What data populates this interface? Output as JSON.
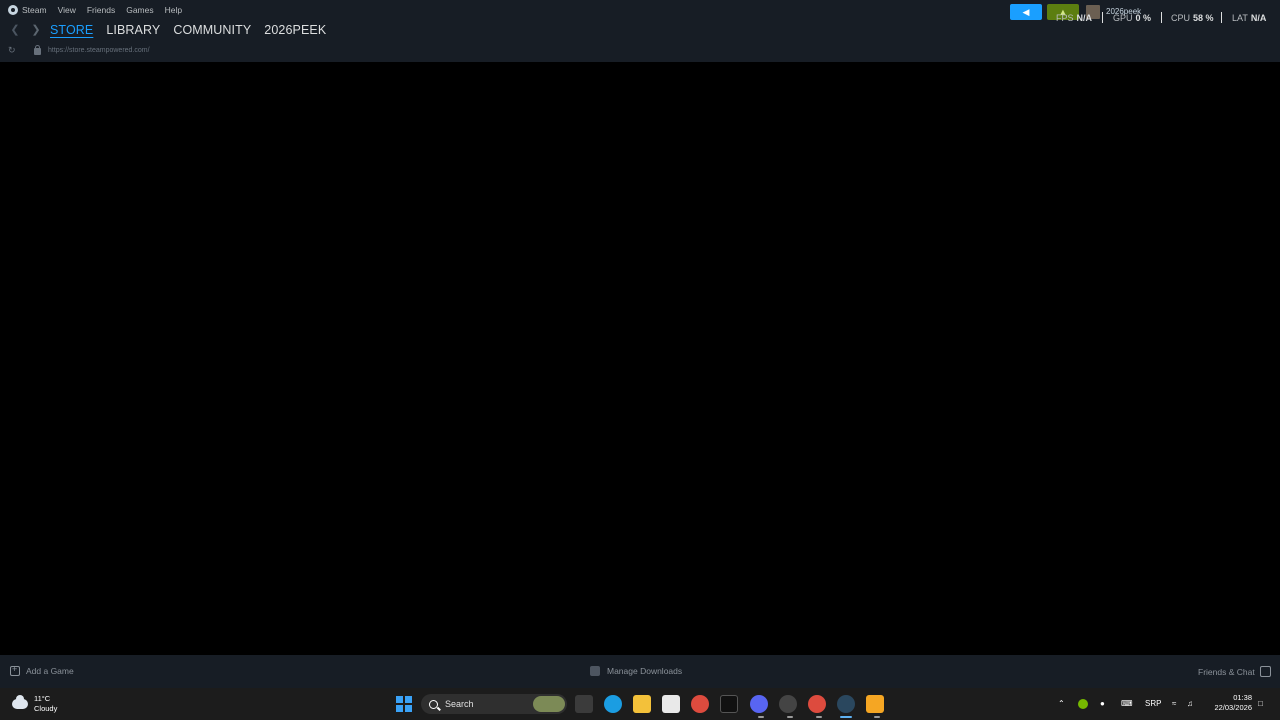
{
  "menu": {
    "steam": "Steam",
    "view": "View",
    "friends": "Friends",
    "games": "Games",
    "help": "Help"
  },
  "nav": {
    "tabs": [
      "STORE",
      "LIBRARY",
      "COMMUNITY",
      "2026PEEK"
    ],
    "active": "STORE"
  },
  "url": "https://store.steampowered.com/",
  "overlay": {
    "user": "2026peek",
    "fps_label": "FPS",
    "fps_value": "N/A",
    "gpu_label": "GPU",
    "gpu_value": "0 %",
    "cpu_label": "CPU",
    "cpu_value": "58 %",
    "lat_label": "LAT",
    "lat_value": "N/A"
  },
  "bottom": {
    "add_game": "Add a Game",
    "manage_downloads": "Manage Downloads",
    "friends_chat": "Friends & Chat"
  },
  "taskbar": {
    "weather_temp": "11°C",
    "weather_desc": "Cloudy",
    "search": "Search",
    "lang": "SRP",
    "time": "01:38",
    "date": "22/03/2026"
  },
  "colors": {
    "accent": "#1a9fff",
    "steam_bg": "#171d25",
    "taskbar_bg": "#1c1c1c"
  }
}
